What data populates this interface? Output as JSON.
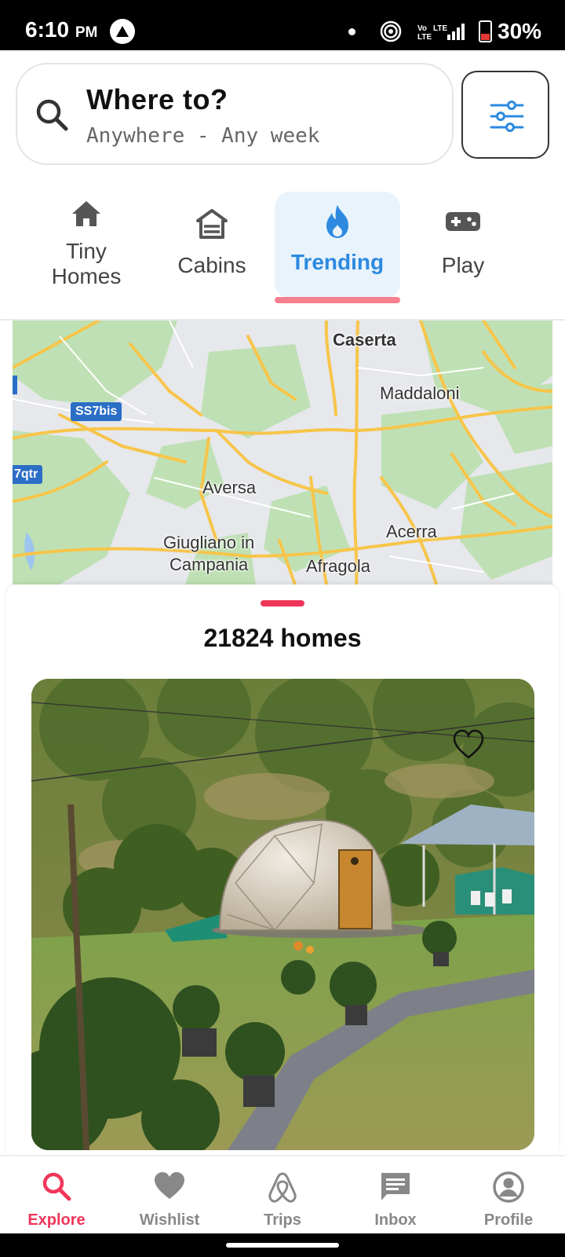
{
  "status_bar": {
    "time": "6:10",
    "ampm": "PM",
    "network": "Vo LTE LTE",
    "battery": "30%"
  },
  "search": {
    "title": "Where to?",
    "subtitle": "Anywhere - Any week",
    "filter_icon": "sliders-icon",
    "search_icon": "search-icon"
  },
  "categories": [
    {
      "label_line1": "Tiny",
      "label_line2": "Homes",
      "icon": "house-icon",
      "active": false
    },
    {
      "label": "Cabins",
      "icon": "cabin-icon",
      "active": false
    },
    {
      "label": "Trending",
      "icon": "flame-icon",
      "active": true
    },
    {
      "label": "Play",
      "icon": "gamepad-icon",
      "active": false
    }
  ],
  "map": {
    "places": [
      "Caserta",
      "Maddaloni",
      "Aversa",
      "Acerra",
      "Giugliano in",
      "Campania",
      "Afragola"
    ],
    "road_badges": [
      "SS7bis",
      "7qtr"
    ]
  },
  "listings": {
    "count_label": "21824 homes",
    "first_listing": {
      "wishlist_icon": "heart-outline-icon"
    }
  },
  "bottom_nav": [
    {
      "label": "Explore",
      "icon": "search-icon",
      "active": true
    },
    {
      "label": "Wishlist",
      "icon": "heart-icon",
      "active": false
    },
    {
      "label": "Trips",
      "icon": "airbnb-logo-icon",
      "active": false
    },
    {
      "label": "Inbox",
      "icon": "message-icon",
      "active": false
    },
    {
      "label": "Profile",
      "icon": "profile-icon",
      "active": false
    }
  ],
  "colors": {
    "accent": "#f0365a",
    "trending_blue": "#2d8ae0",
    "map_green": "#bfe0b4",
    "map_road": "#f7c54a"
  }
}
